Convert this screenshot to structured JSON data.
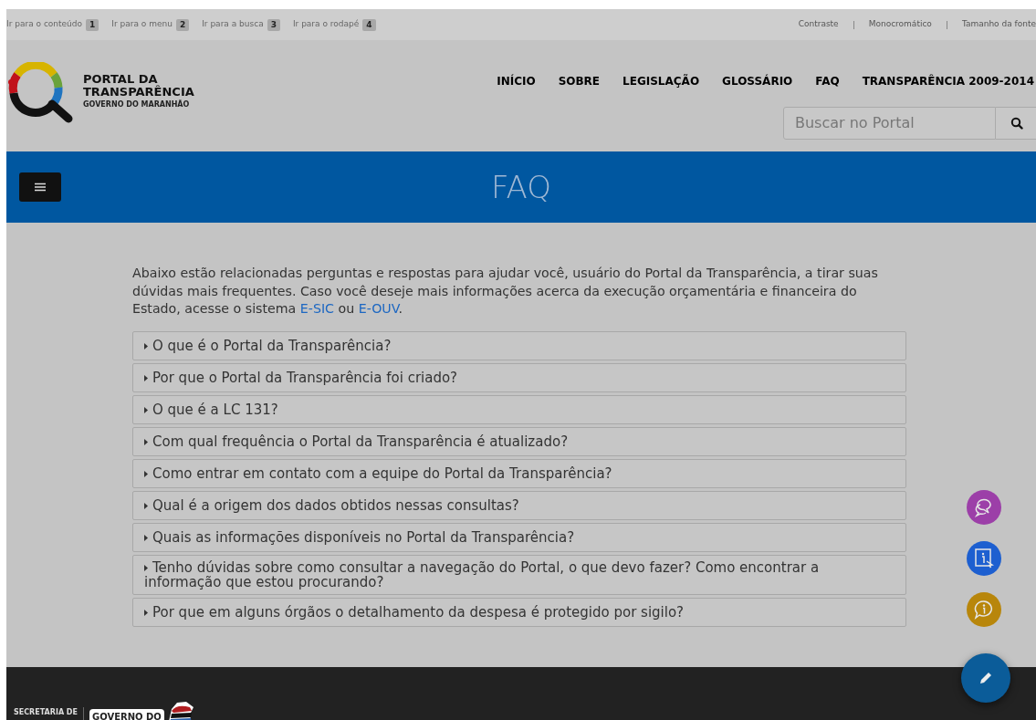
{
  "accessibility_bar": {
    "shortcuts": [
      {
        "label": "Ir para o conteúdo",
        "key": "1"
      },
      {
        "label": "Ir para o menu",
        "key": "2"
      },
      {
        "label": "Ir para a busca",
        "key": "3"
      },
      {
        "label": "Ir para o rodapé",
        "key": "4"
      }
    ],
    "options": [
      "Contraste",
      "Monocromático",
      "Tamanho da fonte"
    ]
  },
  "logo": {
    "title_line_1": "PORTAL DA",
    "title_line_2": "TRANSPARÊNCIA",
    "subtitle": "GOVERNO DO MARANHÃO"
  },
  "nav": [
    "INÍCIO",
    "SOBRE",
    "LEGISLAÇÃO",
    "GLOSSÁRIO",
    "FAQ",
    "TRANSPARÊNCIA 2009-2014"
  ],
  "search": {
    "placeholder": "Buscar no Portal"
  },
  "banner": {
    "title": "FAQ"
  },
  "intro": [
    {
      "kind": "text",
      "text": "Abaixo estão relacionadas perguntas e respostas para ajudar você, usuário do Portal da Transparência, a tirar suas dúvidas mais frequentes. Caso você deseje mais informações acerca da execução orçamentária e financeira do Estado, acesse o sistema "
    },
    {
      "kind": "link",
      "text": "E-SIC"
    },
    {
      "kind": "text",
      "text": " ou "
    },
    {
      "kind": "link",
      "text": "E-OUV"
    },
    {
      "kind": "text",
      "text": "."
    }
  ],
  "faq": [
    {
      "question": "O que é o Portal da Transparência?",
      "expanded": false
    },
    {
      "question": "Por que o Portal da Transparência foi criado?",
      "expanded": false
    },
    {
      "question": "O que é a LC 131?",
      "expanded": false
    },
    {
      "question": "Com qual frequência o Portal da Transparência é atualizado?",
      "expanded": false
    },
    {
      "question": "Como entrar em contato com a equipe do Portal da Transparência?",
      "expanded": false
    },
    {
      "question": "Qual é a origem dos dados obtidos nessas consultas?",
      "expanded": false
    },
    {
      "question": "Quais as informações disponíveis no Portal da Transparência?",
      "expanded": false
    },
    {
      "question": "Tenho dúvidas sobre como consultar a navegação do Portal, o que devo fazer? Como encontrar a informação que estou procurando?",
      "expanded": false
    },
    {
      "question": "Por que em alguns órgãos o detalhamento da despesa é protegido por sigilo?",
      "expanded": false
    }
  ],
  "floating_buttons": [
    {
      "kind": "chat",
      "color": "#9c3fa8"
    },
    {
      "kind": "info-click",
      "color": "#1d5fd0"
    },
    {
      "kind": "info-bubble",
      "color": "#b8860b"
    }
  ],
  "footer": {
    "label": "SECRETARIA DE",
    "badge": "GOVERNO DO"
  }
}
